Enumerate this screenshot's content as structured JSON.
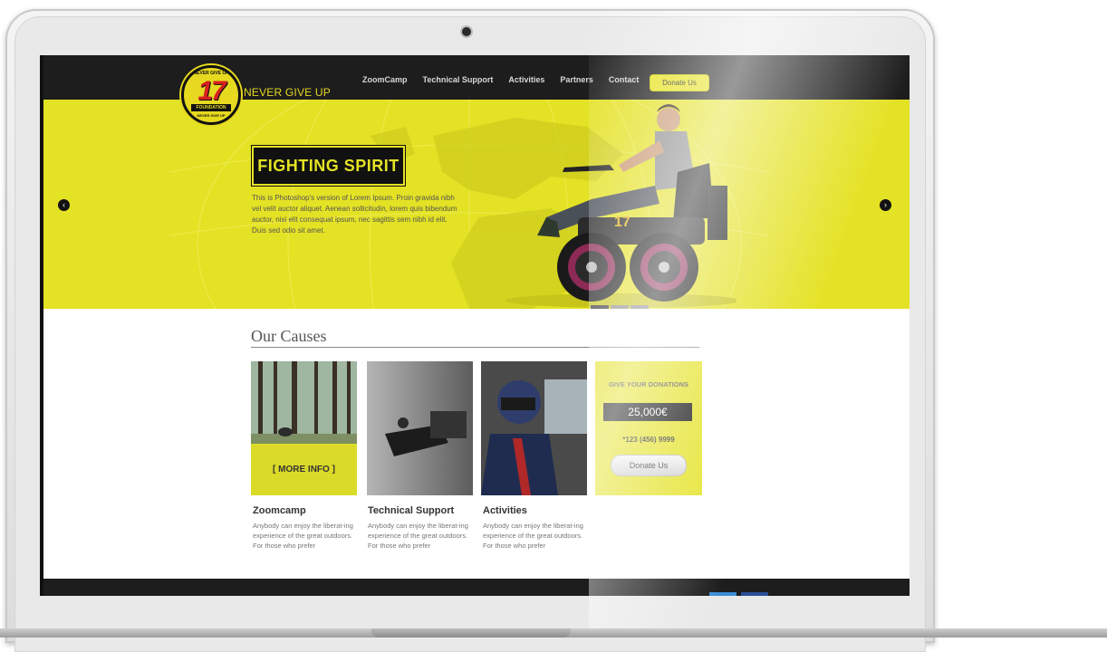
{
  "header": {
    "brand": "NEVER GIVE UP",
    "logo": {
      "top_text": "NEVER GIVE UP",
      "number": "17",
      "plate": "FOUNDATION",
      "bottom_text": "NEVER GIVE UP"
    },
    "nav": [
      "ZoomCamp",
      "Technical Support",
      "Activities",
      "Partners",
      "Contact"
    ],
    "donate_label": "Donate Us"
  },
  "hero": {
    "title": "FIGHTING SPIRIT",
    "text": "This is Photoshop's version  of Lorem Ipsum. Proin gravida nibh vel velit auctor aliquet. Aenean sollicitudin, lorem quis bibendum auctor, nisi elit consequat ipsum, nec sagittis sem nibh id elit. Duis sed odio sit amet.",
    "prev_icon": "chevron-left-icon",
    "next_icon": "chevron-right-icon",
    "slides": 3,
    "active_slide": 1
  },
  "causes": {
    "title": "Our Causes",
    "cards": [
      {
        "title": "Zoomcamp",
        "text": "Anybody can enjoy the liberat-ing experience of the great outdoors. For those who prefer",
        "overlay": "[ MORE INFO ]"
      },
      {
        "title": "Technical Support",
        "text": "Anybody can enjoy the liberat-ing experience of the great outdoors. For those who prefer"
      },
      {
        "title": "Activities",
        "text": "Anybody can enjoy the liberat-ing experience of the great outdoors. For those who prefer"
      }
    ],
    "donation": {
      "heading": "GIVE YOUR DONATIONS",
      "amount": "25,000€",
      "phone": "*123 (456) 9999",
      "button": "Donate Us"
    }
  },
  "colors": {
    "accent": "#e4e224",
    "dark": "#1d1d1d"
  }
}
